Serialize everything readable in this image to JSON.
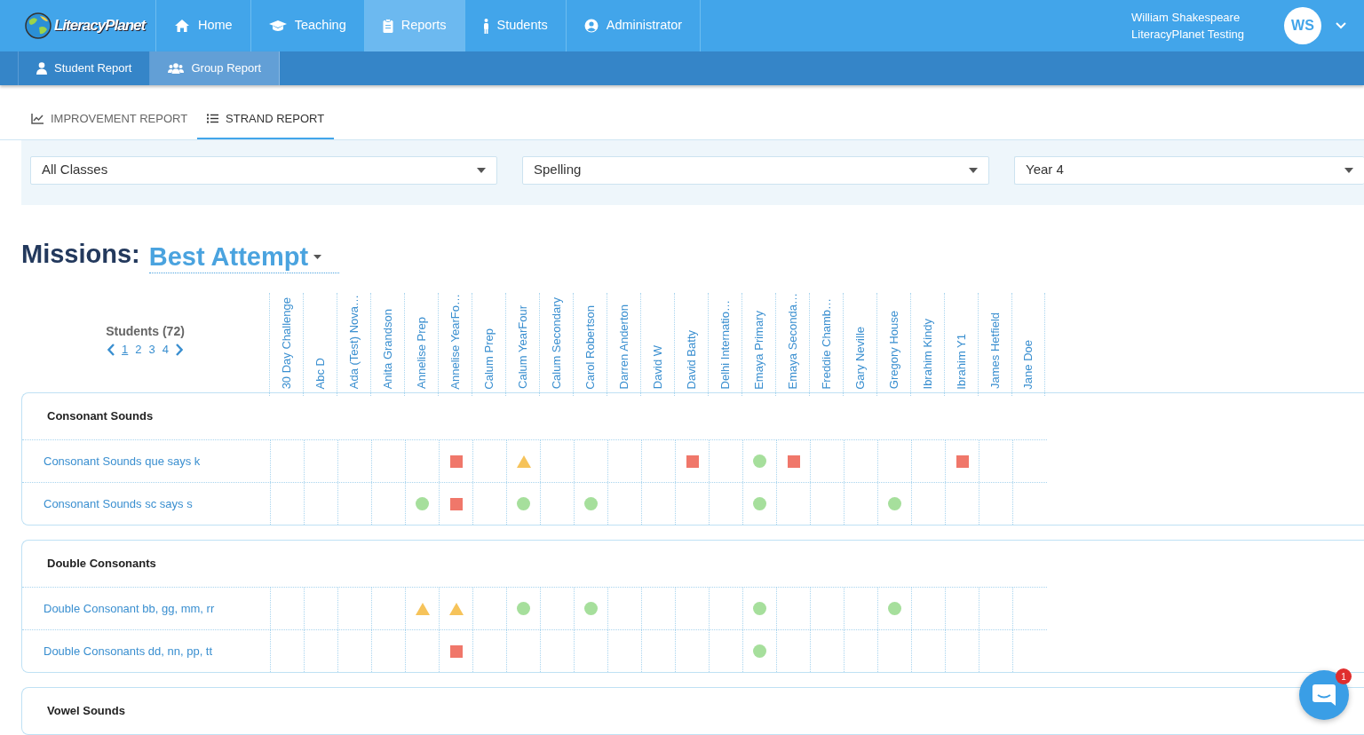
{
  "logo": {
    "text": "LiteracyPlanet"
  },
  "nav": [
    {
      "label": "Home",
      "selected": false
    },
    {
      "label": "Teaching",
      "selected": false
    },
    {
      "label": "Reports",
      "selected": true
    },
    {
      "label": "Students",
      "selected": false
    },
    {
      "label": "Administrator",
      "selected": false
    }
  ],
  "user": {
    "name": "William Shakespeare",
    "org": "LiteracyPlanet Testing",
    "initials": "WS"
  },
  "subnav": [
    {
      "label": "Student Report",
      "selected": false
    },
    {
      "label": "Group Report",
      "selected": true
    }
  ],
  "report_tabs": [
    {
      "label": "IMPROVEMENT REPORT",
      "selected": false
    },
    {
      "label": "STRAND REPORT",
      "selected": true
    }
  ],
  "filters": [
    {
      "value": "All Classes"
    },
    {
      "value": "Spelling"
    },
    {
      "value": "Year 4"
    }
  ],
  "heading": {
    "label": "Missions:",
    "mode": "Best Attempt"
  },
  "students_header": {
    "title": "Students (72)",
    "pages": [
      {
        "label": "1",
        "selected": true
      },
      {
        "label": "2",
        "selected": false
      },
      {
        "label": "3",
        "selected": false
      },
      {
        "label": "4",
        "selected": false
      }
    ]
  },
  "students": [
    "30 Day Challenge",
    "Abc D",
    "Ada (Test) Nova…",
    "Anita Grandson",
    "Annelise Prep",
    "Annelise YearFo…",
    "Calum Prep",
    "Calum YearFour",
    "Calum Secondary",
    "Carol Robertson",
    "Darren Anderton",
    "David W",
    "David Batty",
    "Delhi Internatio…",
    "Emaya Primary",
    "Emaya Seconda…",
    "Freddie Chamb…",
    "Gary Neville",
    "Gregory House",
    "Ibrahim Kindy",
    "Ibrahim Y1",
    "James Hetfield",
    "Jane Doe"
  ],
  "sections": [
    {
      "title": "Consonant Sounds",
      "rows": [
        {
          "label": "Consonant Sounds que says k",
          "cells": [
            {
              "kind": "empty"
            },
            {
              "kind": "empty"
            },
            {
              "kind": "empty"
            },
            {
              "kind": "empty"
            },
            {
              "kind": "empty"
            },
            {
              "kind": "square"
            },
            {
              "kind": "empty"
            },
            {
              "kind": "triangle"
            },
            {
              "kind": "empty"
            },
            {
              "kind": "empty"
            },
            {
              "kind": "empty"
            },
            {
              "kind": "empty"
            },
            {
              "kind": "square"
            },
            {
              "kind": "empty"
            },
            {
              "kind": "circle"
            },
            {
              "kind": "square"
            },
            {
              "kind": "empty"
            },
            {
              "kind": "empty"
            },
            {
              "kind": "empty"
            },
            {
              "kind": "empty"
            },
            {
              "kind": "square"
            },
            {
              "kind": "empty"
            },
            {
              "kind": "empty"
            }
          ]
        },
        {
          "label": "Consonant Sounds sc says s",
          "cells": [
            {
              "kind": "empty"
            },
            {
              "kind": "empty"
            },
            {
              "kind": "empty"
            },
            {
              "kind": "empty"
            },
            {
              "kind": "circle"
            },
            {
              "kind": "square"
            },
            {
              "kind": "empty"
            },
            {
              "kind": "circle"
            },
            {
              "kind": "empty"
            },
            {
              "kind": "circle"
            },
            {
              "kind": "empty"
            },
            {
              "kind": "empty"
            },
            {
              "kind": "empty"
            },
            {
              "kind": "empty"
            },
            {
              "kind": "circle"
            },
            {
              "kind": "empty"
            },
            {
              "kind": "empty"
            },
            {
              "kind": "empty"
            },
            {
              "kind": "circle"
            },
            {
              "kind": "empty"
            },
            {
              "kind": "empty"
            },
            {
              "kind": "empty"
            },
            {
              "kind": "empty"
            }
          ]
        }
      ]
    },
    {
      "title": "Double Consonants",
      "rows": [
        {
          "label": "Double Consonant bb, gg, mm, rr",
          "cells": [
            {
              "kind": "empty"
            },
            {
              "kind": "empty"
            },
            {
              "kind": "empty"
            },
            {
              "kind": "empty"
            },
            {
              "kind": "triangle"
            },
            {
              "kind": "triangle"
            },
            {
              "kind": "empty"
            },
            {
              "kind": "circle"
            },
            {
              "kind": "empty"
            },
            {
              "kind": "circle"
            },
            {
              "kind": "empty"
            },
            {
              "kind": "empty"
            },
            {
              "kind": "empty"
            },
            {
              "kind": "empty"
            },
            {
              "kind": "circle"
            },
            {
              "kind": "empty"
            },
            {
              "kind": "empty"
            },
            {
              "kind": "empty"
            },
            {
              "kind": "circle"
            },
            {
              "kind": "empty"
            },
            {
              "kind": "empty"
            },
            {
              "kind": "empty"
            },
            {
              "kind": "empty"
            }
          ]
        },
        {
          "label": "Double Consonants dd, nn, pp, tt",
          "cells": [
            {
              "kind": "empty"
            },
            {
              "kind": "empty"
            },
            {
              "kind": "empty"
            },
            {
              "kind": "empty"
            },
            {
              "kind": "empty"
            },
            {
              "kind": "square"
            },
            {
              "kind": "empty"
            },
            {
              "kind": "empty"
            },
            {
              "kind": "empty"
            },
            {
              "kind": "empty"
            },
            {
              "kind": "empty"
            },
            {
              "kind": "empty"
            },
            {
              "kind": "empty"
            },
            {
              "kind": "empty"
            },
            {
              "kind": "circle"
            },
            {
              "kind": "empty"
            },
            {
              "kind": "empty"
            },
            {
              "kind": "empty"
            },
            {
              "kind": "empty"
            },
            {
              "kind": "empty"
            },
            {
              "kind": "empty"
            },
            {
              "kind": "empty"
            },
            {
              "kind": "empty"
            }
          ]
        }
      ]
    },
    {
      "title": "Vowel Sounds"
    }
  ],
  "chat": {
    "badge": "1"
  }
}
